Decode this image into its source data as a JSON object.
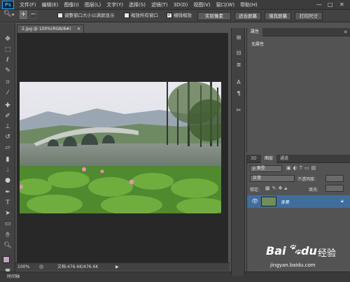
{
  "app": {
    "logo": "Ps"
  },
  "menu": [
    "文件(F)",
    "编辑(E)",
    "图像(I)",
    "图层(L)",
    "文字(Y)",
    "选择(S)",
    "滤镜(T)",
    "3D(D)",
    "视图(V)",
    "窗口(W)",
    "帮助(H)"
  ],
  "window_controls": {
    "minimize": "—",
    "restore": "□",
    "close": "✕"
  },
  "options": {
    "resize_windows": "调整窗口大小以满屏显示",
    "zoom_all": "缩放所有窗口",
    "scrubby_zoom": "细微缩放",
    "actual_pixels": "实际像素",
    "fit_screen": "适合屏幕",
    "fill_screen": "填充屏幕",
    "print_size": "打印尺寸",
    "resize_checked": false,
    "zoom_all_checked": false,
    "scrubby_checked": true
  },
  "document": {
    "tab_title": "2.jpg @ 100%(RGB/8#)",
    "tab_close": "×",
    "zoom": "100%",
    "doc_info": "文档:476.6K/476.6K"
  },
  "timeline": {
    "label": "时间轴"
  },
  "properties": {
    "tab_label": "属性",
    "content": "无属性"
  },
  "layers": {
    "tabs": [
      "3D",
      "图层",
      "通道"
    ],
    "filter_label": "ρ 类型",
    "blend_mode": "正常",
    "opacity_label": "不透明度:",
    "lock_label": "锁定:",
    "fill_label": "填充:",
    "layer_name": "背景"
  },
  "watermark": {
    "brand": "Bai",
    "brand2": "du",
    "brand_cn": "经验",
    "url": "jingyan.baidu.com"
  },
  "colors": {
    "accent": "#31a8ff",
    "layer_selected": "#3f6e9e",
    "foreground": "#c7a2c8",
    "background": "#ffffff"
  }
}
